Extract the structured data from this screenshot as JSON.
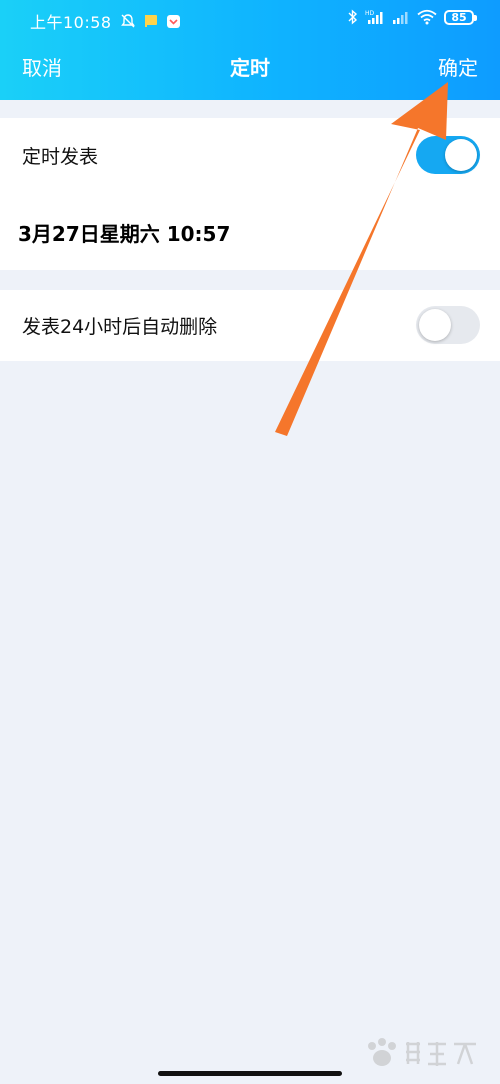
{
  "status_bar": {
    "time": "上午10:58",
    "battery": "85",
    "icons": [
      "mute-bell-icon",
      "notification-flag-icon",
      "app-notification-icon",
      "bluetooth-icon",
      "hd-signal-icon",
      "signal-icon",
      "wifi-icon",
      "battery-icon"
    ]
  },
  "nav": {
    "cancel": "取消",
    "title": "定时",
    "confirm": "确定"
  },
  "schedule": {
    "label": "定时发表",
    "enabled": true,
    "datetime": "3月27日星期六 10:57"
  },
  "auto_delete": {
    "label": "发表24小时后自动删除",
    "enabled": false
  },
  "colors": {
    "header_start": "#1ad0f8",
    "header_end": "#0e9cff",
    "toggle_on": "#15a8f2",
    "toggle_off": "#e6e9ee",
    "arrow": "#f5762b",
    "background": "#eef2f9"
  }
}
